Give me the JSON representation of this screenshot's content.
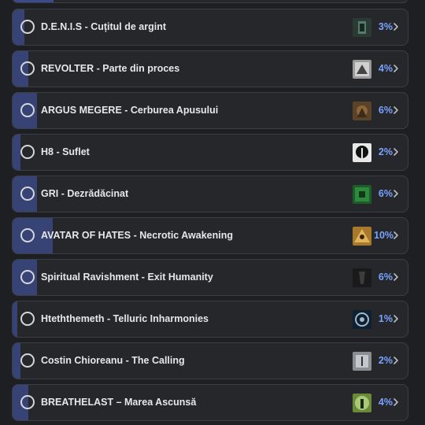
{
  "poll": {
    "top_fragment_percent": 10,
    "options": [
      {
        "label": "D.E.N.I.S - Cuțitul de argint",
        "percent_label": "3%",
        "percent": 3,
        "thumb_icon": "album-cover-icon",
        "thumb_color": "#2b3a33"
      },
      {
        "label": "REVOLTER - Parte din proces",
        "percent_label": "4%",
        "percent": 4,
        "thumb_icon": "album-cover-icon",
        "thumb_color": "#9a9a9a"
      },
      {
        "label": "ARGUS MEGERE - Cerburea Apusului",
        "percent_label": "6%",
        "percent": 6,
        "thumb_icon": "album-cover-icon",
        "thumb_color": "#5a4328"
      },
      {
        "label": "H8 - Suflet",
        "percent_label": "2%",
        "percent": 2,
        "thumb_icon": "album-cover-icon",
        "thumb_color": "#e8e8e8"
      },
      {
        "label": "GRI - Dezrădăcinat",
        "percent_label": "6%",
        "percent": 6,
        "thumb_icon": "album-cover-icon",
        "thumb_color": "#1f5a2a"
      },
      {
        "label": "AVATAR OF HATES - Necrotic Awakening",
        "percent_label": "10%",
        "percent": 10,
        "thumb_icon": "album-cover-icon",
        "thumb_color": "#a8782c"
      },
      {
        "label": "Spiritual Ravishment - Exit Humanity",
        "percent_label": "6%",
        "percent": 6,
        "thumb_icon": "album-cover-icon",
        "thumb_color": "#1a1a1a"
      },
      {
        "label": "Hteththemeth - Telluric Inharmonies",
        "percent_label": "1%",
        "percent": 1,
        "thumb_icon": "album-cover-icon",
        "thumb_color": "#0f2030"
      },
      {
        "label": "Costin Chioreanu - The Calling",
        "percent_label": "2%",
        "percent": 2,
        "thumb_icon": "album-cover-icon",
        "thumb_color": "#8a8f94"
      },
      {
        "label": "BREATHELAST – Marea Ascunsă",
        "percent_label": "4%",
        "percent": 4,
        "thumb_icon": "album-cover-icon",
        "thumb_color": "#6a8a3a"
      }
    ]
  },
  "colors": {
    "background": "#1e1f22",
    "card": "#25272b",
    "fill": "#384375",
    "accent_text": "#7aa3ff"
  }
}
